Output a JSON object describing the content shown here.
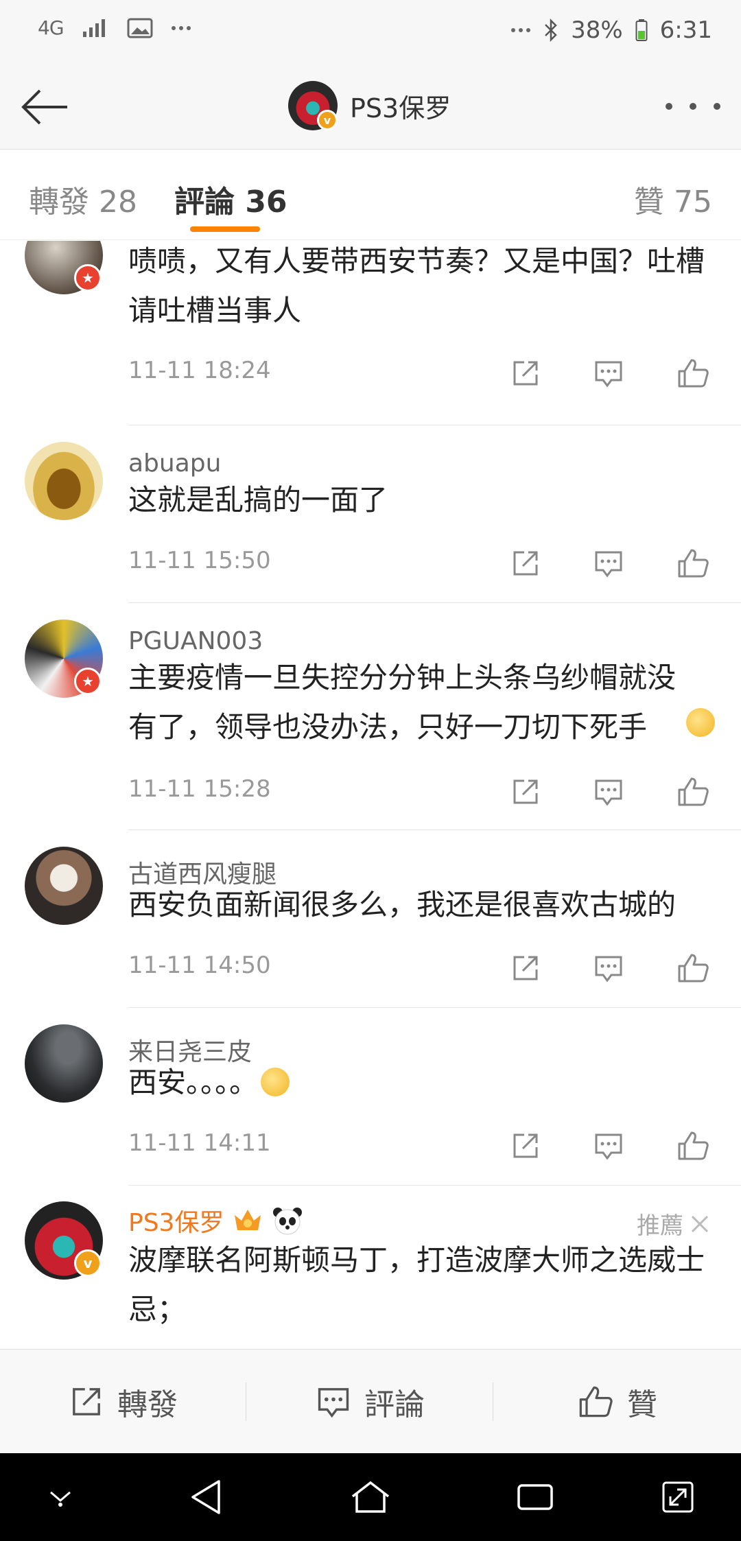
{
  "status_bar": {
    "network": "4G",
    "battery": "38%",
    "time": "6:31"
  },
  "header": {
    "title": "PS3保罗",
    "icons": {
      "back": "back-arrow-icon",
      "more": "more-dots-icon"
    }
  },
  "tabs": {
    "repost": "轉發 28",
    "comment": "評論 36",
    "like": "贊 75",
    "active": "comment"
  },
  "comments": [
    {
      "username": "",
      "text": "啧啧，又有人要带西安节奏？又是中国？吐槽请吐槽当事人",
      "time": "11-11 18:24"
    },
    {
      "username": "abuapu",
      "text": "这就是乱搞的一面了",
      "time": "11-11 15:50"
    },
    {
      "username": "PGUAN003",
      "text": "主要疫情一旦失控分分钟上头条乌纱帽就没有了，领导也没办法，只好一刀切下死手",
      "time": "11-11 15:28"
    },
    {
      "username": "古道西风瘦腿",
      "text": "西安负面新闻很多么，我还是很喜欢古城的",
      "time": "11-11 14:50"
    },
    {
      "username": "来日尧三皮",
      "text": "西安。。。。",
      "time": "11-11 14:11"
    },
    {
      "username": "PS3保罗",
      "text": "波摩联名阿斯顿马丁，打造波摩大师之选威士忌；",
      "recommended_label": "推薦"
    }
  ],
  "bottom_bar": {
    "repost": "轉發",
    "comment": "評論",
    "like": "贊"
  },
  "colors": {
    "accent": "#ff8200",
    "vip_name": "#f0781e",
    "badge_red": "#e8412f"
  }
}
